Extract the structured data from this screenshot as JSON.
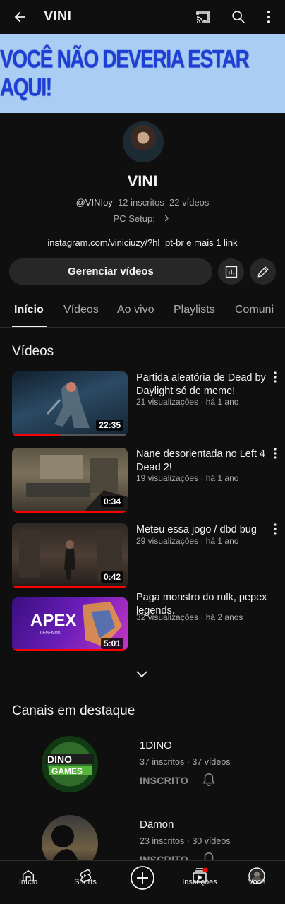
{
  "topbar": {
    "title": "VINI"
  },
  "banner": {
    "text": "VOCÊ NÃO DEVERIA ESTAR AQUI!"
  },
  "channel": {
    "name": "VINI",
    "handle": "@VINIoy",
    "subscribers": "12 inscritos",
    "videos": "22 vídeos",
    "description": "PC Setup:",
    "link": "instagram.com/viniciuzy/?hl=pt-br e mais 1 link"
  },
  "actions": {
    "manage_label": "Gerenciar vídeos"
  },
  "tabs": [
    {
      "label": "Início"
    },
    {
      "label": "Vídeos"
    },
    {
      "label": "Ao vivo"
    },
    {
      "label": "Playlists"
    },
    {
      "label": "Comuni"
    }
  ],
  "videos_section": {
    "title": "Vídeos"
  },
  "videos": [
    {
      "title": "Partida aleatória de Dead by Daylight só de meme!",
      "meta": "21 visualizações · há 1 ano",
      "duration": "22:35",
      "watched": 0.41,
      "thumb_colors": [
        "#1a2a3a",
        "#3d5a73"
      ]
    },
    {
      "title": "Nane desorientada no Left 4 Dead 2!",
      "meta": "19 visualizações · há 1 ano",
      "duration": "0:34",
      "watched": 1.0,
      "thumb_colors": [
        "#4a4233",
        "#7a6d55"
      ]
    },
    {
      "title": "Meteu essa jogo / dbd bug",
      "meta": "29 visualizações · há 1 ano",
      "duration": "0:42",
      "watched": 1.0,
      "thumb_colors": [
        "#2a2420",
        "#4d3f35"
      ]
    },
    {
      "title": "Paga monstro do rulk, pepex legends.",
      "meta": "32 visualizações · há 2 anos",
      "duration": "5:01",
      "watched": 1.0,
      "thumb_colors": [
        "#5a16a8",
        "#b032c8"
      ]
    }
  ],
  "featured_section": {
    "title": "Canais em destaque"
  },
  "featured_channels": [
    {
      "name": "1DINO",
      "meta": "37 inscritos · 37 vídeos",
      "subscribed_label": "INSCRITO"
    },
    {
      "name": "Dämon",
      "meta": "23 inscritos · 30 vídeos",
      "subscribed_label": "INSCRITO"
    }
  ],
  "nav": [
    {
      "label": "Início",
      "icon": "home-icon"
    },
    {
      "label": "Shorts",
      "icon": "shorts-icon"
    },
    {
      "label": "",
      "icon": "create-icon"
    },
    {
      "label": "Inscrições",
      "icon": "subscriptions-icon"
    },
    {
      "label": "Você",
      "icon": "you-avatar-icon"
    }
  ],
  "colors": {
    "background": "#0f0f0f",
    "accent": "#ff0000",
    "banner_bg": "#a9cdf3",
    "banner_text": "#1d3fd6"
  }
}
